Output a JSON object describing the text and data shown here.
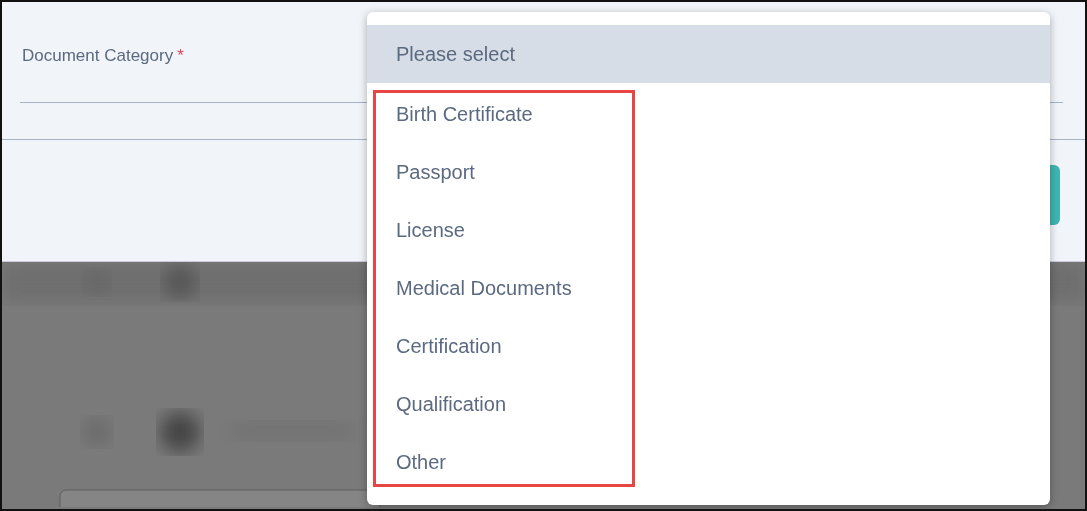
{
  "form": {
    "label": "Document Category",
    "required_mark": "*"
  },
  "dropdown": {
    "placeholder": "Please select",
    "options": [
      "Birth Certificate",
      "Passport",
      "License",
      "Medical Documents",
      "Certification",
      "Qualification",
      "Other"
    ]
  }
}
